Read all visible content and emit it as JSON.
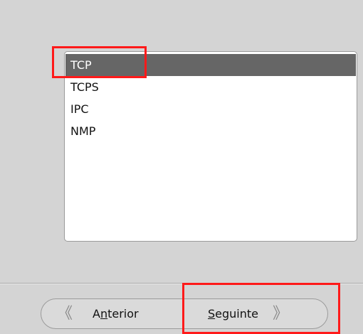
{
  "list": {
    "items": [
      "TCP",
      "TCPS",
      "IPC",
      "NMP"
    ],
    "selected_index": 0
  },
  "nav": {
    "back_before": "A",
    "back_mnemonic": "n",
    "back_after": "terior",
    "next_before": "",
    "next_mnemonic": "S",
    "next_after": "eguinte"
  },
  "colors": {
    "background": "#d4d4d4",
    "selection": "#666666",
    "highlight": "#ff1a1a"
  },
  "icons": {
    "back": "double-chevron-left-icon",
    "next": "double-chevron-right-icon"
  }
}
